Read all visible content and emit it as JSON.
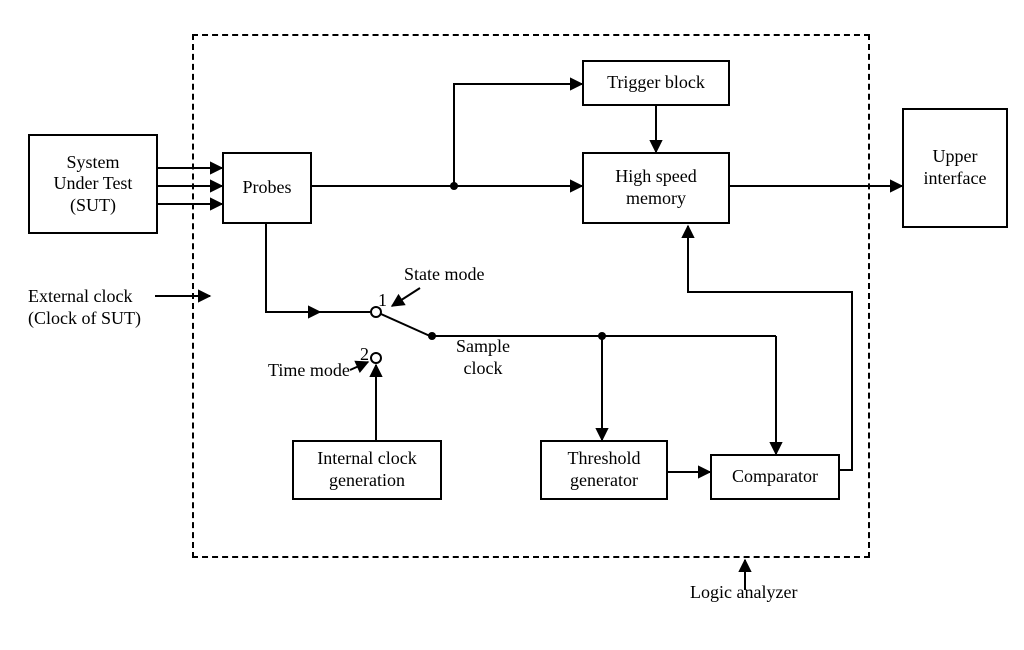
{
  "boxes": {
    "sut": "System\nUnder Test\n(SUT)",
    "probes": "Probes",
    "trigger": "Trigger block",
    "memory": "High speed\nmemory",
    "upper": "Upper\ninterface",
    "intclock": "Internal clock\ngeneration",
    "threshold": "Threshold\ngenerator",
    "comparator": "Comparator"
  },
  "labels": {
    "ext_clock": "External clock\n(Clock of SUT)",
    "state_mode": "State mode",
    "time_mode": "Time mode",
    "sample_clock": "Sample\nclock",
    "analyzer": "Logic analyzer",
    "pos1": "1",
    "pos2": "2"
  }
}
